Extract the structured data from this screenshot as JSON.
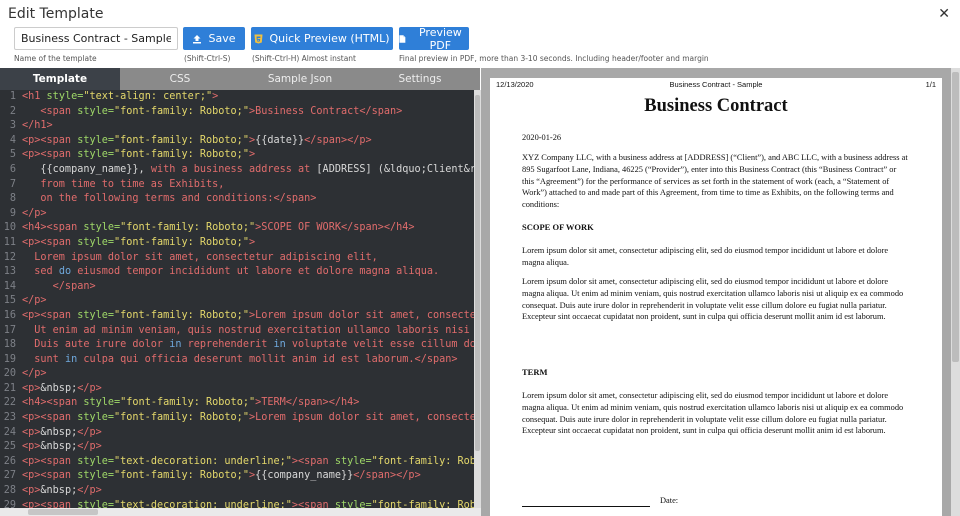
{
  "window": {
    "title": "Edit Template"
  },
  "toolbar": {
    "name_value": "Business Contract - Sample",
    "name_hint": "Name of the template",
    "save_label": "Save",
    "save_hint": "(Shift-Ctrl-S)",
    "quick_preview_label": "Quick Preview (HTML)",
    "quick_preview_hint": "(Shift-Ctrl-H) Almost instant",
    "preview_pdf_label": "Preview PDF",
    "preview_pdf_hint": "Final preview in PDF, more than 3-10 seconds. Including header/footer and margin"
  },
  "tabs": [
    {
      "label": "Template",
      "active": true
    },
    {
      "label": "CSS",
      "active": false
    },
    {
      "label": "Sample Json",
      "active": false
    },
    {
      "label": "Settings",
      "active": false
    }
  ],
  "editor": {
    "lines": [
      [
        [
          "r",
          "<h1 "
        ],
        [
          "g",
          "style="
        ],
        [
          "y",
          "\"text-align: center;\""
        ],
        [
          "r",
          ">"
        ]
      ],
      [
        [
          "r",
          "   <span "
        ],
        [
          "g",
          "style="
        ],
        [
          "y",
          "\"font-family: Roboto;\""
        ],
        [
          "r",
          ">Business Contract</span>"
        ]
      ],
      [
        [
          "r",
          "</h1>"
        ]
      ],
      [
        [
          "r",
          "<p><span "
        ],
        [
          "g",
          "style="
        ],
        [
          "y",
          "\"font-family: Roboto;\""
        ],
        [
          "r",
          ">"
        ],
        [
          "w",
          "{{date}}"
        ],
        [
          "r",
          "</span></p>"
        ]
      ],
      [
        [
          "r",
          "<p><span "
        ],
        [
          "g",
          "style="
        ],
        [
          "y",
          "\"font-family: Roboto;\""
        ],
        [
          "r",
          ">"
        ]
      ],
      [
        [
          "w",
          "   {{company_name}}, "
        ],
        [
          "r",
          "with a business address at "
        ],
        [
          "w",
          "[ADDRESS] (&ldquo;Client&rdquo;"
        ]
      ],
      [
        [
          "r",
          "   from time to time as Exhibits,"
        ]
      ],
      [
        [
          "r",
          "   on the following terms and conditions:</span>"
        ]
      ],
      [
        [
          "r",
          "</p>"
        ]
      ],
      [
        [
          "r",
          "<h4><span "
        ],
        [
          "g",
          "style="
        ],
        [
          "y",
          "\"font-family: Roboto;\""
        ],
        [
          "r",
          ">SCOPE OF WORK</span></h4>"
        ]
      ],
      [
        [
          "r",
          "<p><span "
        ],
        [
          "g",
          "style="
        ],
        [
          "y",
          "\"font-family: Roboto;\""
        ],
        [
          "r",
          ">"
        ]
      ],
      [
        [
          "r",
          "  Lorem ipsum dolor sit amet, consectetur adipiscing elit,"
        ]
      ],
      [
        [
          "r",
          "  sed "
        ],
        [
          "b",
          "do"
        ],
        [
          "r",
          " eiusmod tempor incididunt ut labore et dolore magna aliqua."
        ]
      ],
      [
        [
          "r",
          "     </span>"
        ]
      ],
      [
        [
          "r",
          "</p>"
        ]
      ],
      [
        [
          "r",
          "<p><span "
        ],
        [
          "g",
          "style="
        ],
        [
          "y",
          "\"font-family: Roboto;\""
        ],
        [
          "r",
          ">Lorem ipsum dolor sit amet, consectetur"
        ]
      ],
      [
        [
          "r",
          "  Ut enim ad minim veniam, quis nostrud exercitation ullamco laboris nisi ut"
        ]
      ],
      [
        [
          "r",
          "  Duis aute irure dolor "
        ],
        [
          "b",
          "in"
        ],
        [
          "r",
          " reprehenderit "
        ],
        [
          "b",
          "in"
        ],
        [
          "r",
          " voluptate velit esse cillum dolo"
        ]
      ],
      [
        [
          "r",
          "  sunt "
        ],
        [
          "b",
          "in"
        ],
        [
          "r",
          " culpa qui officia deserunt mollit anim id est laborum.</span>"
        ]
      ],
      [
        [
          "r",
          "</p>"
        ]
      ],
      [
        [
          "r",
          "<p>"
        ],
        [
          "w",
          "&nbsp;"
        ],
        [
          "r",
          "</p>"
        ]
      ],
      [
        [
          "r",
          "<h4><span "
        ],
        [
          "g",
          "style="
        ],
        [
          "y",
          "\"font-family: Roboto;\""
        ],
        [
          "r",
          ">TERM</span></h4>"
        ]
      ],
      [
        [
          "r",
          "<p><span "
        ],
        [
          "g",
          "style="
        ],
        [
          "y",
          "\"font-family: Roboto;\""
        ],
        [
          "r",
          ">Lorem ipsum dolor sit amet, consectetur"
        ]
      ],
      [
        [
          "r",
          "<p>"
        ],
        [
          "w",
          "&nbsp;"
        ],
        [
          "r",
          "</p>"
        ]
      ],
      [
        [
          "r",
          "<p>"
        ],
        [
          "w",
          "&nbsp;"
        ],
        [
          "r",
          "</p>"
        ]
      ],
      [
        [
          "r",
          "<p><span "
        ],
        [
          "g",
          "style="
        ],
        [
          "y",
          "\"text-decoration: underline;\""
        ],
        [
          "r",
          "><span "
        ],
        [
          "g",
          "style="
        ],
        [
          "y",
          "\"font-family: Roboto"
        ]
      ],
      [
        [
          "r",
          "<p><span "
        ],
        [
          "g",
          "style="
        ],
        [
          "y",
          "\"font-family: Roboto;\""
        ],
        [
          "r",
          ">"
        ],
        [
          "w",
          "{{company_name}}"
        ],
        [
          "r",
          "</span></p>"
        ]
      ],
      [
        [
          "r",
          "<p>"
        ],
        [
          "w",
          "&nbsp;"
        ],
        [
          "r",
          "</p>"
        ]
      ],
      [
        [
          "r",
          "<p><span "
        ],
        [
          "g",
          "style="
        ],
        [
          "y",
          "\"text-decoration: underline;\""
        ],
        [
          "r",
          "><span "
        ],
        [
          "g",
          "style="
        ],
        [
          "y",
          "\"font-family: Roboto"
        ]
      ]
    ]
  },
  "preview": {
    "header_date": "12/13/2020",
    "header_title": "Business Contract - Sample",
    "header_page": "1/1",
    "doc_title": "Business Contract",
    "date": "2020-01-26",
    "intro": "XYZ Company LLC, with a business address at [ADDRESS] (“Client”), and ABC LLC, with a business address at 895 Sugarfoot Lane, Indiana, 46225 (“Provider”), enter into this Business Contract (this “Business Contract” or this “Agreement”) for the performance of services as set forth in the statement of work (each, a “Statement of Work”) attached to and made part of this Agreement, from time to time as Exhibits, on the following terms and conditions:",
    "scope_heading": "SCOPE OF WORK",
    "scope_p1": "Lorem ipsum dolor sit amet, consectetur adipiscing elit, sed do eiusmod tempor incididunt ut labore et dolore magna aliqua.",
    "scope_p2": "Lorem ipsum dolor sit amet, consectetur adipiscing elit, sed do eiusmod tempor incididunt ut labore et dolore magna aliqua. Ut enim ad minim veniam, quis nostrud exercitation ullamco laboris nisi ut aliquip ex ea commodo consequat. Duis aute irure dolor in reprehenderit in voluptate velit esse cillum dolore eu fugiat nulla pariatur. Excepteur sint occaecat cupidatat non proident, sunt in culpa qui officia deserunt mollit anim id est laborum.",
    "term_heading": "TERM",
    "term_p1": "Lorem ipsum dolor sit amet, consectetur adipiscing elit, sed do eiusmod tempor incididunt ut labore et dolore magna aliqua. Ut enim ad minim veniam, quis nostrud exercitation ullamco laboris nisi ut aliquip ex ea commodo consequat. Duis aute irure dolor in reprehenderit in voluptate velit esse cillum dolore eu fugiat nulla pariatur. Excepteur sint occaecat cupidatat non proident, sunt in culpa qui officia deserunt mollit anim id est laborum.",
    "date_label": "Date:"
  },
  "icons": {
    "close": "close-icon",
    "save": "upload-icon",
    "quick_preview": "html5-icon",
    "preview_pdf": "file-icon"
  },
  "colors": {
    "accent": "#2f7fd8",
    "editor_bg": "#2d3034",
    "tab_bar": "#8a8a8a",
    "preview_bg": "#a8a8a8"
  }
}
